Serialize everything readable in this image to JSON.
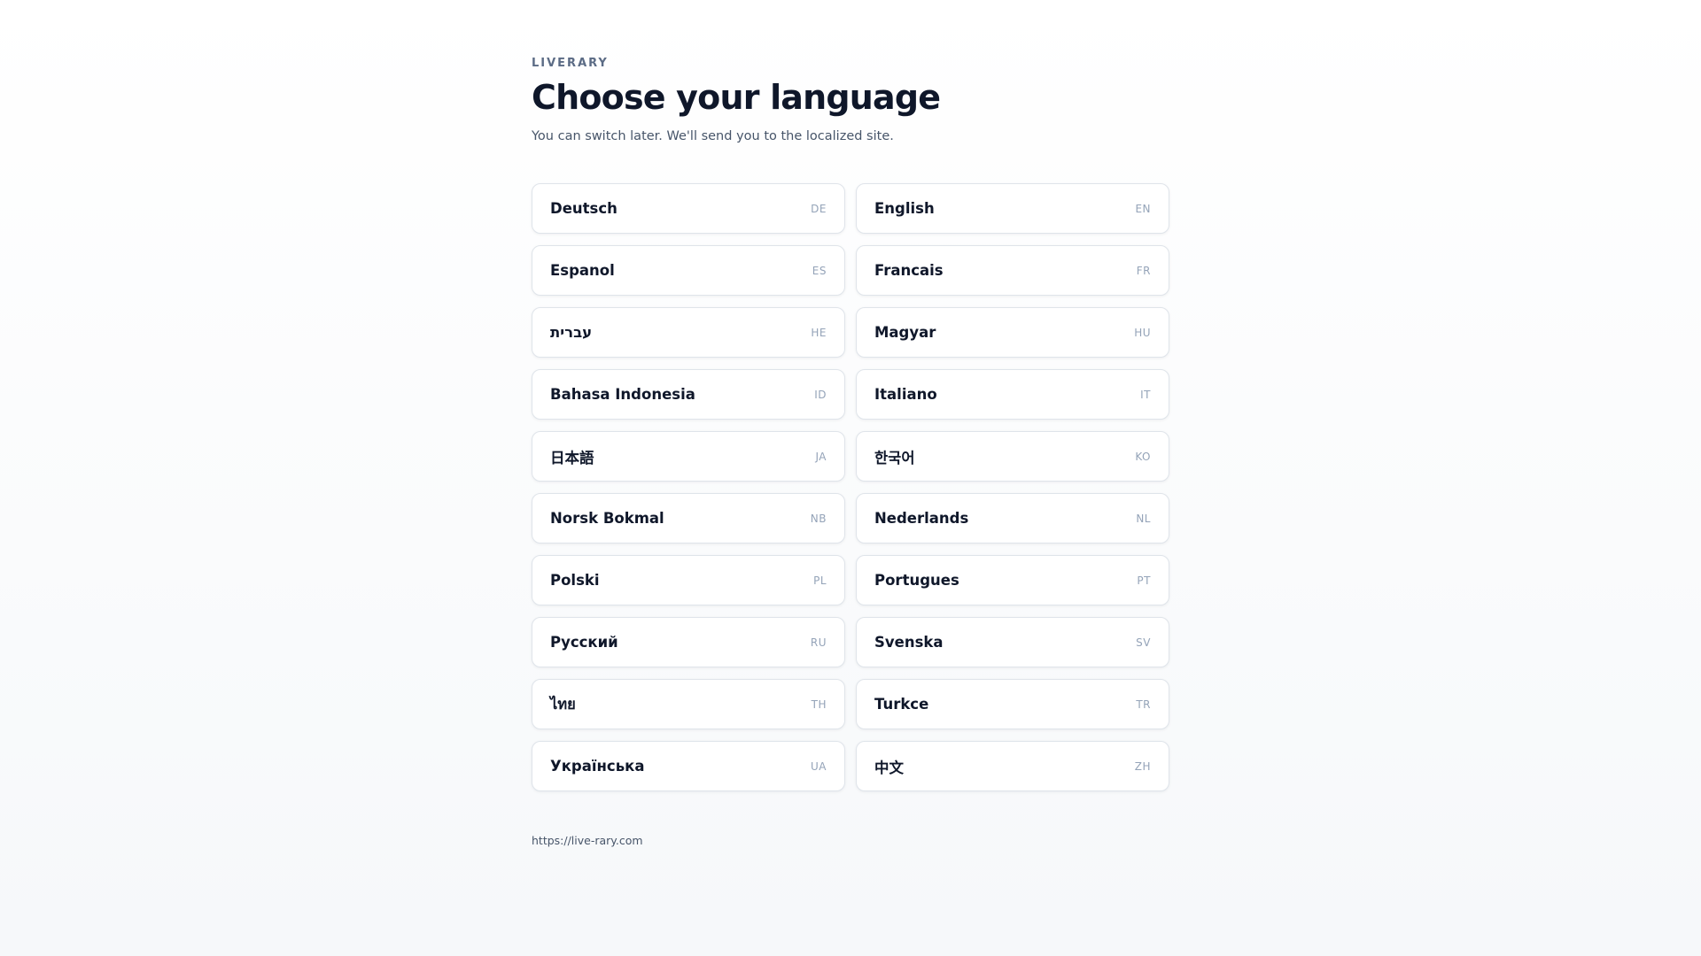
{
  "header": {
    "brand": "LIVERARY",
    "title": "Choose your language",
    "subtitle": "You can switch later. We'll send you to the localized site."
  },
  "languages": [
    {
      "name": "Deutsch",
      "code": "DE"
    },
    {
      "name": "English",
      "code": "EN"
    },
    {
      "name": "Espanol",
      "code": "ES"
    },
    {
      "name": "Francais",
      "code": "FR"
    },
    {
      "name": "עברית",
      "code": "HE"
    },
    {
      "name": "Magyar",
      "code": "HU"
    },
    {
      "name": "Bahasa Indonesia",
      "code": "ID"
    },
    {
      "name": "Italiano",
      "code": "IT"
    },
    {
      "name": "日本語",
      "code": "JA"
    },
    {
      "name": "한국어",
      "code": "KO"
    },
    {
      "name": "Norsk Bokmal",
      "code": "NB"
    },
    {
      "name": "Nederlands",
      "code": "NL"
    },
    {
      "name": "Polski",
      "code": "PL"
    },
    {
      "name": "Portugues",
      "code": "PT"
    },
    {
      "name": "Русский",
      "code": "RU"
    },
    {
      "name": "Svenska",
      "code": "SV"
    },
    {
      "name": "ไทย",
      "code": "TH"
    },
    {
      "name": "Turkce",
      "code": "TR"
    },
    {
      "name": "Українська",
      "code": "UA"
    },
    {
      "name": "中文",
      "code": "ZH"
    }
  ],
  "footer": {
    "url": "https://live-rary.com"
  },
  "colors": {
    "background": "#f6f8fa",
    "card": "#ffffff",
    "card_border": "#dfe4ea",
    "title": "#0f172a",
    "muted": "#475569",
    "code": "#94a3b8",
    "brand": "#5b6b85"
  }
}
